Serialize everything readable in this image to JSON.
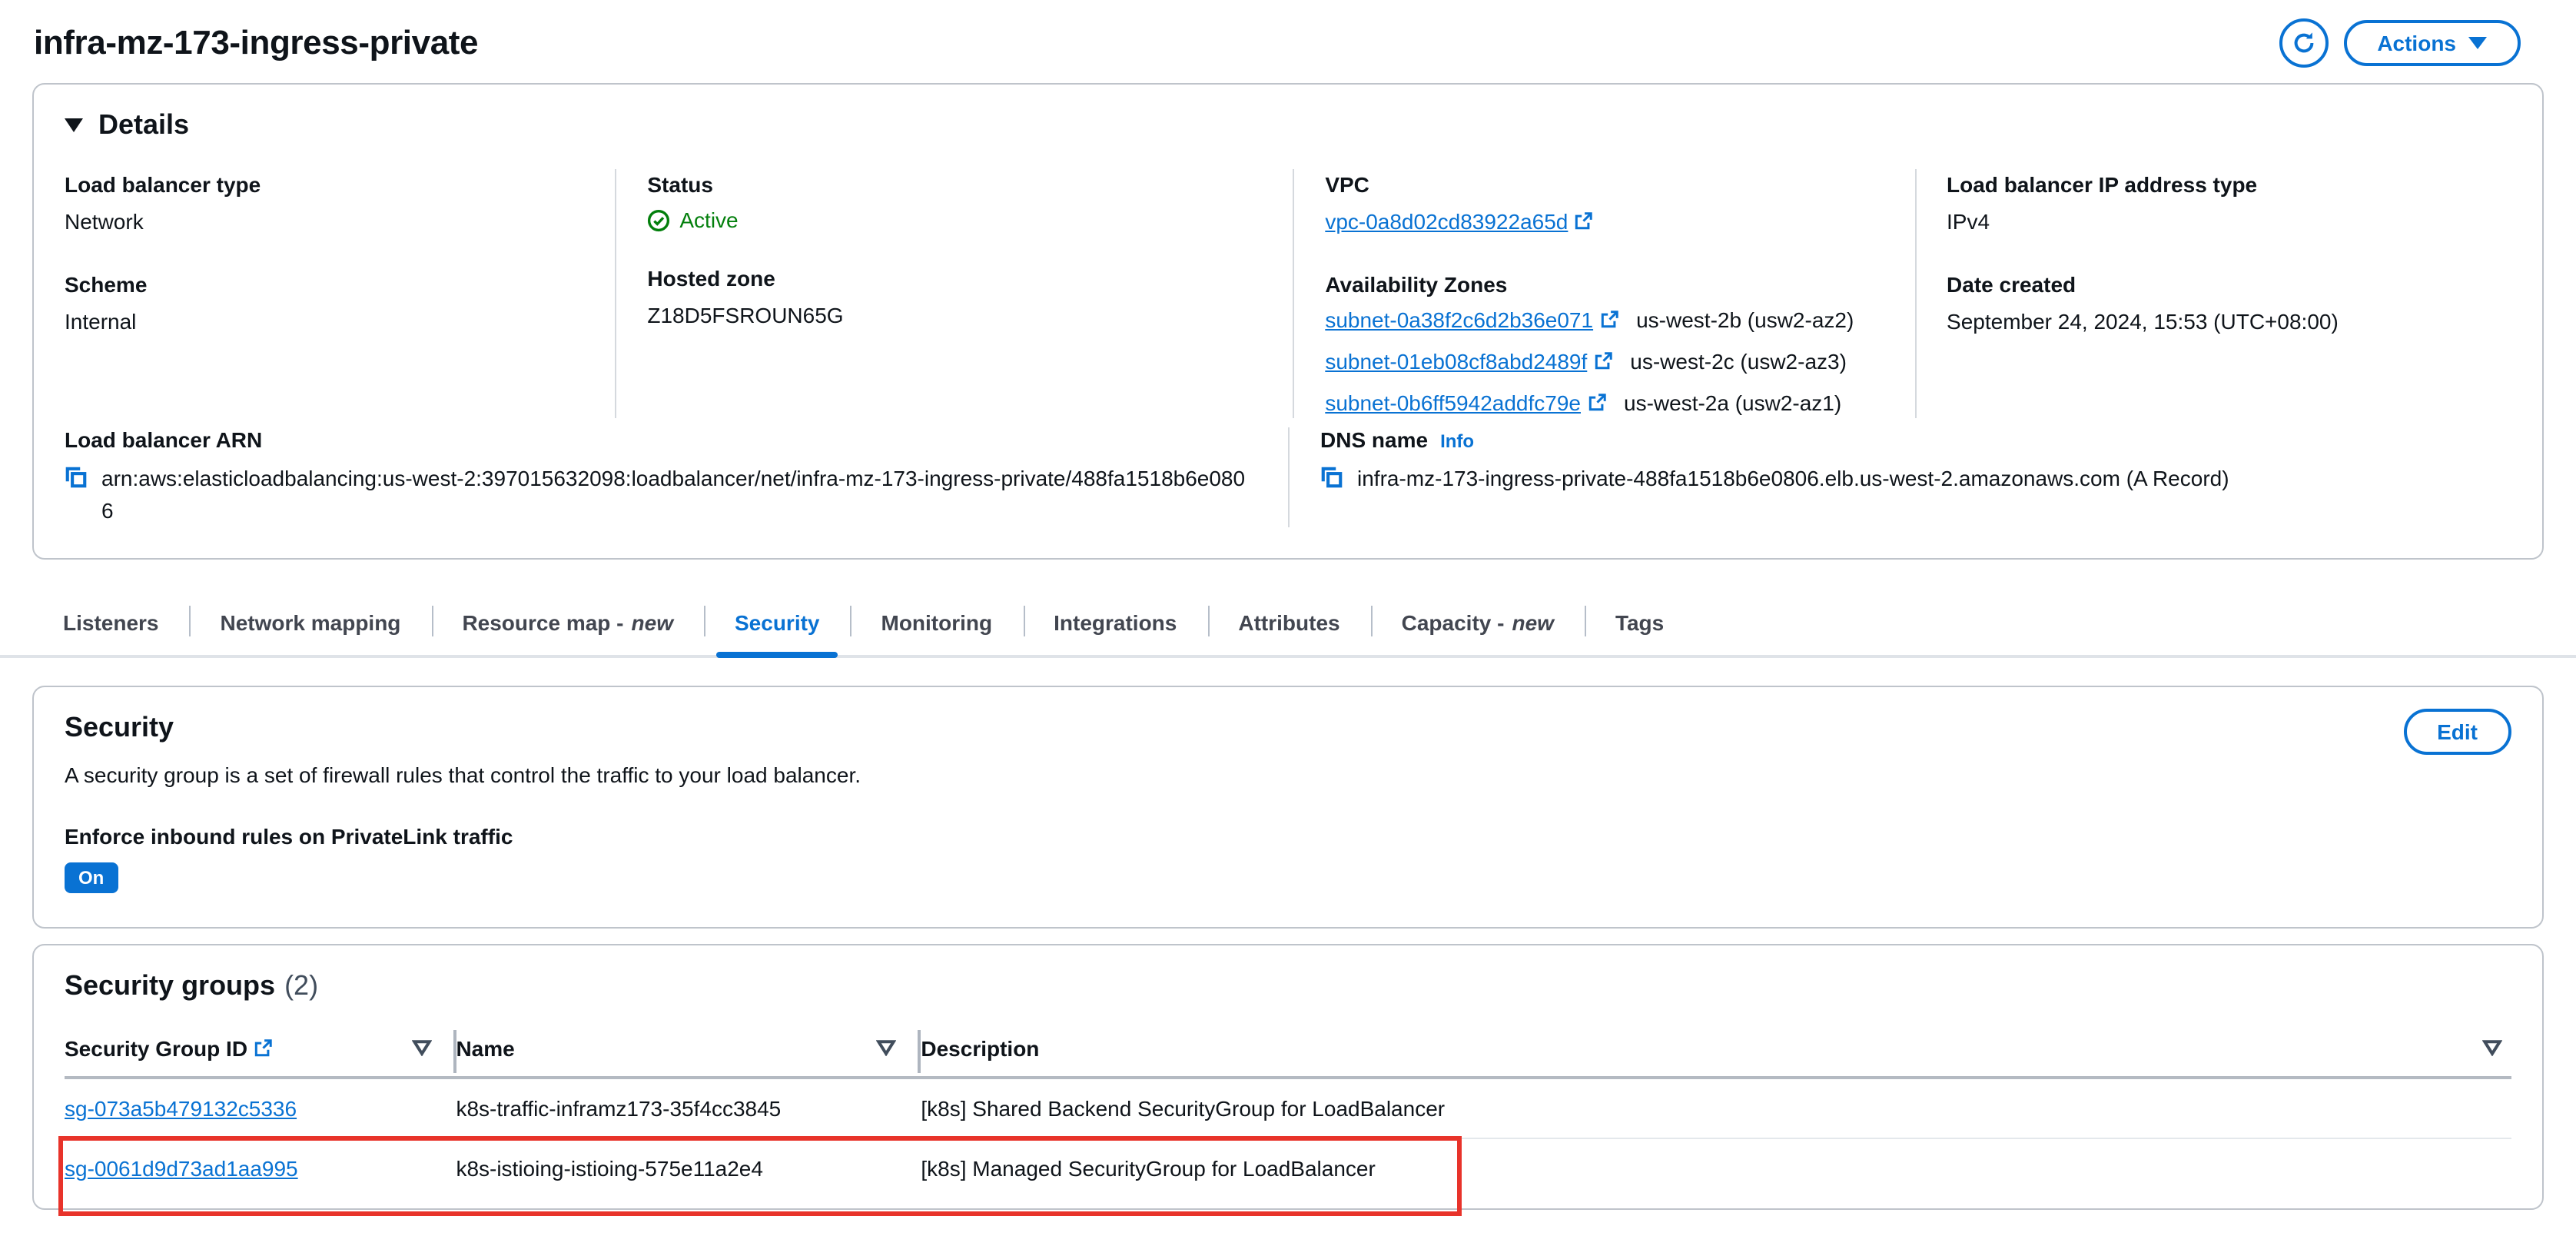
{
  "page": {
    "title": "infra-mz-173-ingress-private"
  },
  "toolbar": {
    "actions_label": "Actions"
  },
  "details": {
    "title": "Details",
    "load_balancer_type": {
      "label": "Load balancer type",
      "value": "Network"
    },
    "scheme": {
      "label": "Scheme",
      "value": "Internal"
    },
    "status": {
      "label": "Status",
      "value": "Active"
    },
    "hosted_zone": {
      "label": "Hosted zone",
      "value": "Z18D5FSROUN65G"
    },
    "vpc": {
      "label": "VPC",
      "value": "vpc-0a8d02cd83922a65d"
    },
    "availability_zones": {
      "label": "Availability Zones",
      "items": [
        {
          "subnet": "subnet-0a38f2c6d2b36e071",
          "zone": "us-west-2b (usw2-az2)"
        },
        {
          "subnet": "subnet-01eb08cf8abd2489f",
          "zone": "us-west-2c (usw2-az3)"
        },
        {
          "subnet": "subnet-0b6ff5942addfc79e",
          "zone": "us-west-2a (usw2-az1)"
        }
      ]
    },
    "ip_type": {
      "label": "Load balancer IP address type",
      "value": "IPv4"
    },
    "date_created": {
      "label": "Date created",
      "value": "September 24, 2024, 15:53 (UTC+08:00)"
    },
    "arn": {
      "label": "Load balancer ARN",
      "value": "arn:aws:elasticloadbalancing:us-west-2:397015632098:loadbalancer/net/infra-mz-173-ingress-private/488fa1518b6e0806"
    },
    "dns": {
      "label": "DNS name",
      "info": "Info",
      "value": "infra-mz-173-ingress-private-488fa1518b6e0806.elb.us-west-2.amazonaws.com (A Record)"
    }
  },
  "tabs": [
    {
      "label": "Listeners"
    },
    {
      "label": "Network mapping"
    },
    {
      "label": "Resource map -",
      "suffix": "new"
    },
    {
      "label": "Security",
      "active": true
    },
    {
      "label": "Monitoring"
    },
    {
      "label": "Integrations"
    },
    {
      "label": "Attributes"
    },
    {
      "label": "Capacity -",
      "suffix": "new"
    },
    {
      "label": "Tags"
    }
  ],
  "security_panel": {
    "title": "Security",
    "description": "A security group is a set of firewall rules that control the traffic to your load balancer.",
    "privatelink_label": "Enforce inbound rules on PrivateLink traffic",
    "privatelink_value": "On",
    "edit_label": "Edit"
  },
  "security_groups": {
    "title": "Security groups",
    "count": "(2)",
    "columns": [
      "Security Group ID",
      "Name",
      "Description"
    ],
    "rows": [
      {
        "id": "sg-073a5b479132c5336",
        "name": "k8s-traffic-inframz173-35f4cc3845",
        "description": "[k8s] Shared Backend SecurityGroup for LoadBalancer"
      },
      {
        "id": "sg-0061d9d73ad1aa995",
        "name": "k8s-istioing-istioing-575e11a2e4",
        "description": "[k8s] Managed SecurityGroup for LoadBalancer"
      }
    ]
  },
  "icons": {
    "refresh": "circular-arrow",
    "caret-down": "filled-down-triangle",
    "details-collapse": "filled-down-triangle",
    "status-active": "check-in-circle",
    "external-link": "box-with-arrow",
    "copy": "overlapping-squares",
    "sort": "outline-down-triangle"
  },
  "colors": {
    "link": "#0972d3",
    "green": "#037f0c",
    "badge": "#0972d3",
    "highlight": "#e8332a"
  }
}
